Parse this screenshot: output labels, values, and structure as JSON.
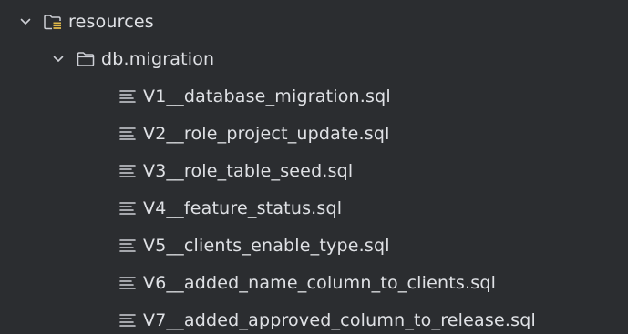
{
  "tree": {
    "resources": {
      "label": "resources",
      "icon": "resources-folder-icon",
      "expanded": true
    },
    "db_migration": {
      "label": "db.migration",
      "icon": "folder-icon",
      "expanded": true
    },
    "files": [
      {
        "label": "V1__database_migration.sql",
        "icon": "sql-file-icon"
      },
      {
        "label": "V2__role_project_update.sql",
        "icon": "sql-file-icon"
      },
      {
        "label": "V3__role_table_seed.sql",
        "icon": "sql-file-icon"
      },
      {
        "label": "V4__feature_status.sql",
        "icon": "sql-file-icon"
      },
      {
        "label": "V5__clients_enable_type.sql",
        "icon": "sql-file-icon"
      },
      {
        "label": "V6__added_name_column_to_clients.sql",
        "icon": "sql-file-icon"
      },
      {
        "label": "V7__added_approved_column_to_release.sql",
        "icon": "sql-file-icon"
      }
    ]
  },
  "colors": {
    "background": "#2b2d30",
    "text": "#dfe1e5",
    "icon": "#ced0d6",
    "resources_accent": "#e0b94a"
  }
}
